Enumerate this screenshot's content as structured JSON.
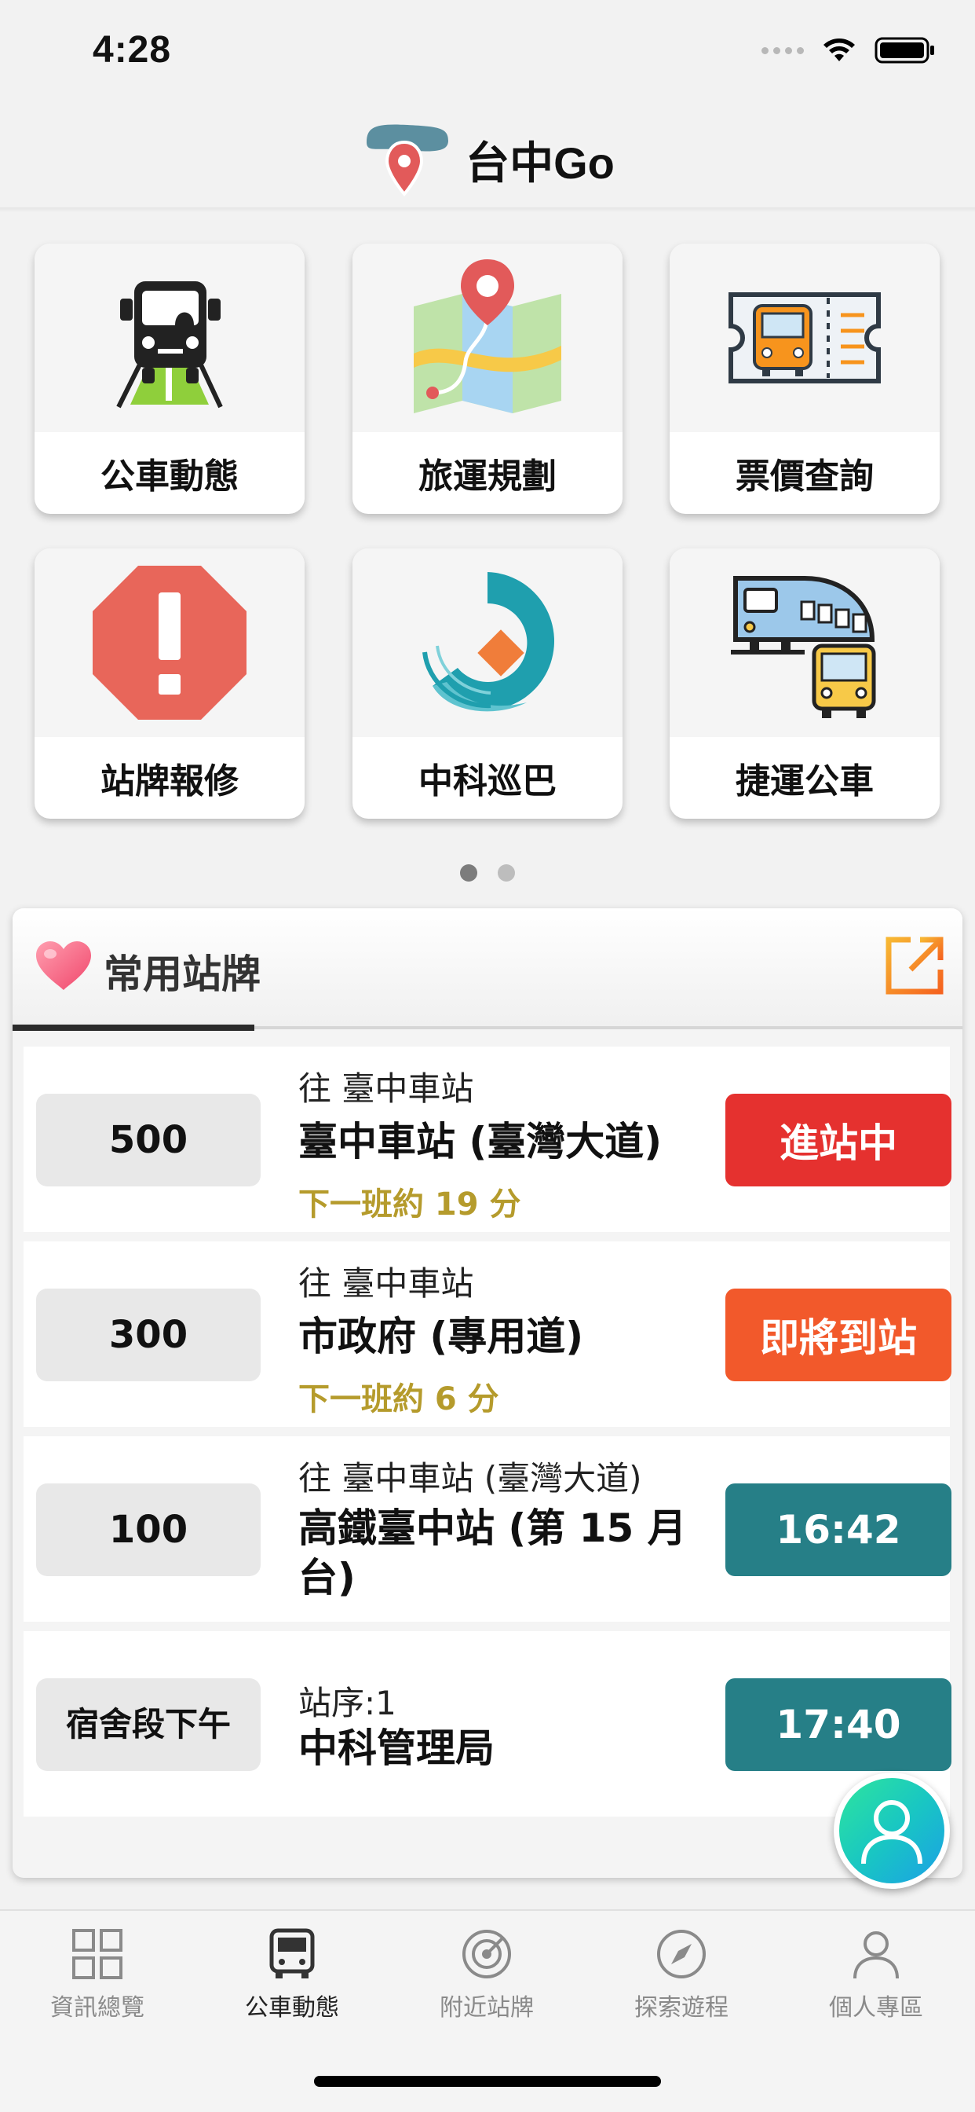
{
  "status_bar": {
    "time": "4:28"
  },
  "header": {
    "title": "台中Go"
  },
  "grid": {
    "tiles": [
      {
        "label": "公車動態",
        "icon": "bus-front-icon"
      },
      {
        "label": "旅運規劃",
        "icon": "map-pin-icon"
      },
      {
        "label": "票價查詢",
        "icon": "ticket-icon"
      },
      {
        "label": "站牌報修",
        "icon": "warning-octagon-icon"
      },
      {
        "label": "中科巡巴",
        "icon": "science-park-logo-icon"
      },
      {
        "label": "捷運公車",
        "icon": "metro-bus-icon"
      }
    ],
    "page_count": 2,
    "active_page": 1
  },
  "favorites": {
    "title": "常用站牌",
    "rows": [
      {
        "route": "500",
        "destination": "往 臺中車站",
        "stop": "臺中車站 (臺灣大道)",
        "next": "下一班約 19 分",
        "eta": "進站中",
        "eta_color": "#e5312f"
      },
      {
        "route": "300",
        "destination": "往 臺中車站",
        "stop": "市政府 (專用道)",
        "next": "下一班約 6 分",
        "eta": "即將到站",
        "eta_color": "#f2592b"
      },
      {
        "route": "100",
        "destination": "往 臺中車站 (臺灣大道)",
        "stop": "高鐵臺中站 (第 15 月台)",
        "next": "",
        "eta": "16:42",
        "eta_color": "#267f87"
      },
      {
        "route": "宿舍段下午",
        "destination": "站序:1",
        "stop": "中科管理局",
        "next": "",
        "eta": "17:40",
        "eta_color": "#267f87"
      }
    ]
  },
  "tab_bar": {
    "tabs": [
      {
        "label": "資訊總覽",
        "icon": "grid-icon"
      },
      {
        "label": "公車動態",
        "icon": "bus-icon"
      },
      {
        "label": "附近站牌",
        "icon": "radar-icon"
      },
      {
        "label": "探索遊程",
        "icon": "compass-icon"
      },
      {
        "label": "個人專區",
        "icon": "person-icon"
      }
    ],
    "active_tab": "公車動態"
  },
  "colors": {
    "accent_orange": "#f39c12",
    "brand_teal": "#267f87",
    "arriving_red": "#e5312f",
    "soon_orange": "#f2592b",
    "next_gold": "#b59b2c"
  }
}
